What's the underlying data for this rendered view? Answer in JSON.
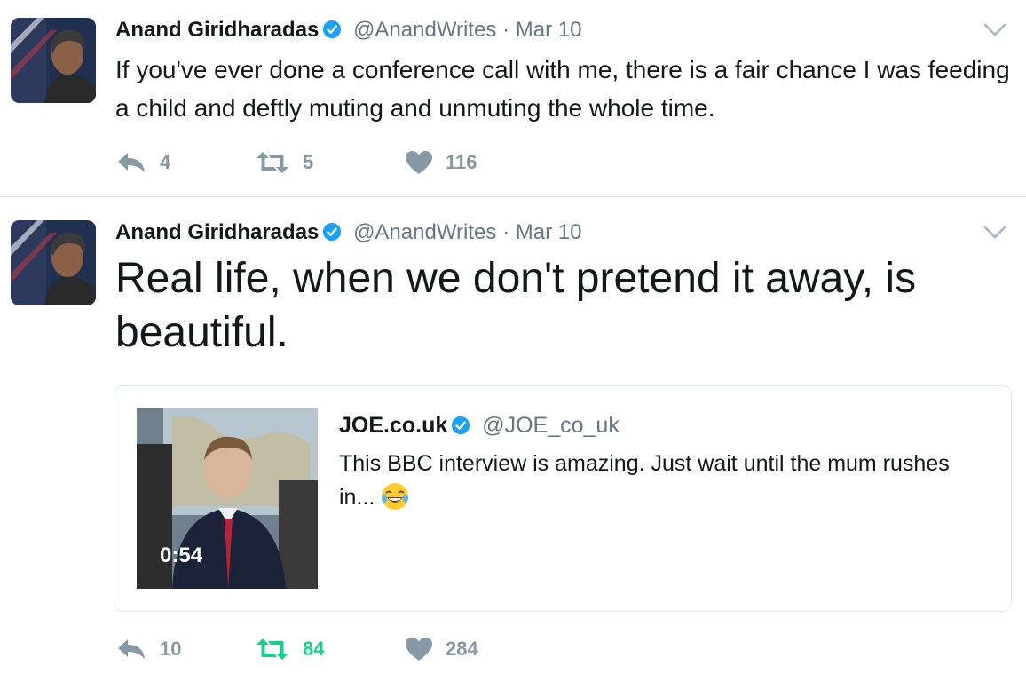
{
  "tweets": [
    {
      "author_name": "Anand Giridharadas",
      "handle": "@AnandWrites",
      "separator": "·",
      "date": "Mar 10",
      "text": "If you've ever done a conference call with me, there is a fair chance I was feeding a child and deftly muting and unmuting the whole time.",
      "replies": "4",
      "retweets": "5",
      "likes": "116",
      "retweeted": false
    },
    {
      "author_name": "Anand Giridharadas",
      "handle": "@AnandWrites",
      "separator": "·",
      "date": "Mar 10",
      "text": "Real life, when we don't pretend it away, is beautiful.",
      "replies": "10",
      "retweets": "84",
      "likes": "284",
      "retweeted": true,
      "quoted": {
        "author_name": "JOE.co.uk",
        "handle": "@JOE_co_uk",
        "text": "This BBC interview is amazing. Just wait until the mum rushes in...",
        "emoji": "face-with-tears-of-joy",
        "video_duration": "0:54"
      }
    }
  ],
  "colors": {
    "text": "#14171a",
    "secondary": "#657786",
    "action_icon": "#8899a6",
    "verified": "#1da1f2",
    "retweet_active": "#19cf86",
    "divider": "#e1e8ed"
  },
  "icons": {
    "verified": "verified-badge-icon",
    "reply": "reply-icon",
    "retweet": "retweet-icon",
    "like": "heart-icon",
    "caret": "chevron-down-icon"
  }
}
